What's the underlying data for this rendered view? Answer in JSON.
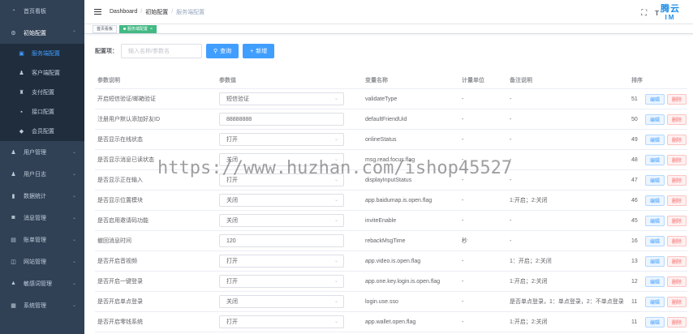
{
  "sidebar": {
    "items": [
      {
        "label": "首页看板",
        "icon": "dashboard-icon",
        "glyph": "◔"
      },
      {
        "label": "初始配置",
        "icon": "settings-icon",
        "glyph": "⚙",
        "open": true,
        "children": [
          {
            "label": "服务端配置",
            "icon": "server-icon",
            "glyph": "▣",
            "active": true
          },
          {
            "label": "客户端配置",
            "icon": "user-icon",
            "glyph": "♟"
          },
          {
            "label": "支付配置",
            "icon": "pay-icon",
            "glyph": "♜"
          },
          {
            "label": "接口配置",
            "icon": "api-icon",
            "glyph": "▪"
          },
          {
            "label": "会员配置",
            "icon": "member-icon",
            "glyph": "◆"
          }
        ]
      },
      {
        "label": "用户管理",
        "icon": "users-icon",
        "glyph": "♟"
      },
      {
        "label": "用户日志",
        "icon": "log-icon",
        "glyph": "♟"
      },
      {
        "label": "数据统计",
        "icon": "chart-icon",
        "glyph": "▮"
      },
      {
        "label": "消息管理",
        "icon": "message-icon",
        "glyph": "◙"
      },
      {
        "label": "账单管理",
        "icon": "bill-icon",
        "glyph": "▤"
      },
      {
        "label": "网站管理",
        "icon": "website-icon",
        "glyph": "◫"
      },
      {
        "label": "敏感词管理",
        "icon": "warning-icon",
        "glyph": "▲"
      },
      {
        "label": "系统管理",
        "icon": "system-icon",
        "glyph": "▦"
      }
    ]
  },
  "header": {
    "breadcrumb": [
      "Dashboard",
      "初始配置",
      "服务端配置"
    ],
    "size_icon": "T",
    "logo_line1": "腾云",
    "logo_line2": "IM"
  },
  "tags": [
    {
      "label": "首页看板",
      "active": false
    },
    {
      "label": "服务端配置",
      "active": true,
      "close": "×"
    }
  ],
  "search": {
    "label": "配置项：",
    "placeholder": "输入名称/参数名",
    "query_label": "查询",
    "add_label": "新增"
  },
  "table": {
    "headers": [
      "参数说明",
      "参数值",
      "变量名称",
      "计量单位",
      "备注说明",
      "排序"
    ],
    "edit_label": "编辑",
    "delete_label": "删除",
    "rows": [
      {
        "desc": "开启短信验证/邮箱验证",
        "value": "短信验证",
        "select": true,
        "var": "validateType",
        "unit": "-",
        "note": "-",
        "sort": "51"
      },
      {
        "desc": "注册用户默认添加好友ID",
        "value": "88888888",
        "select": false,
        "var": "defaultFriendUid",
        "unit": "-",
        "note": "-",
        "sort": "50"
      },
      {
        "desc": "是否显示在线状态",
        "value": "打开",
        "select": true,
        "var": "onlineStatus",
        "unit": "-",
        "note": "-",
        "sort": "49"
      },
      {
        "desc": "是否显示消息已读状态",
        "value": "关闭",
        "select": true,
        "var": "msg.read.focus.flag",
        "unit": "-",
        "note": "-",
        "sort": "48"
      },
      {
        "desc": "是否显示正在输入",
        "value": "打开",
        "select": true,
        "var": "displayInputStatus",
        "unit": "-",
        "note": "-",
        "sort": "47"
      },
      {
        "desc": "是否显示位置模块",
        "value": "关闭",
        "select": true,
        "var": "app.baidumap.is.open.flag",
        "unit": "-",
        "note": "1:开启；2:关闭",
        "sort": "46"
      },
      {
        "desc": "是否启用邀请码功能",
        "value": "关闭",
        "select": true,
        "var": "inviteEnable",
        "unit": "-",
        "note": "-",
        "sort": "45"
      },
      {
        "desc": "撤回消息时间",
        "value": "120",
        "select": false,
        "var": "rebackMsgTime",
        "unit": "秒",
        "note": "-",
        "sort": "16"
      },
      {
        "desc": "是否开启音视频",
        "value": "打开",
        "select": true,
        "var": "app.video.is.open.flag",
        "unit": "-",
        "note": "1：开启；2:关闭",
        "sort": "13"
      },
      {
        "desc": "是否开启一键登录",
        "value": "打开",
        "select": true,
        "var": "app.one.key.login.is.open.flag",
        "unit": "-",
        "note": "1:开启；2:关闭",
        "sort": "12"
      },
      {
        "desc": "是否开启单点登录",
        "value": "关闭",
        "select": true,
        "var": "login.use.sso",
        "unit": "-",
        "note": "是否单点登录，1：单点登录，2：不单点登录",
        "sort": "11"
      },
      {
        "desc": "是否开启零钱系统",
        "value": "打开",
        "select": true,
        "var": "app.wallet.open.flag",
        "unit": "-",
        "note": "1:开启；2:关闭",
        "sort": "11"
      }
    ]
  },
  "watermark": "https://www.huzhan.com/ishop45527",
  "colors": {
    "sidebar_bg": "#304156",
    "primary": "#409eff",
    "active_tag": "#42b983",
    "danger": "#f56c6c"
  }
}
